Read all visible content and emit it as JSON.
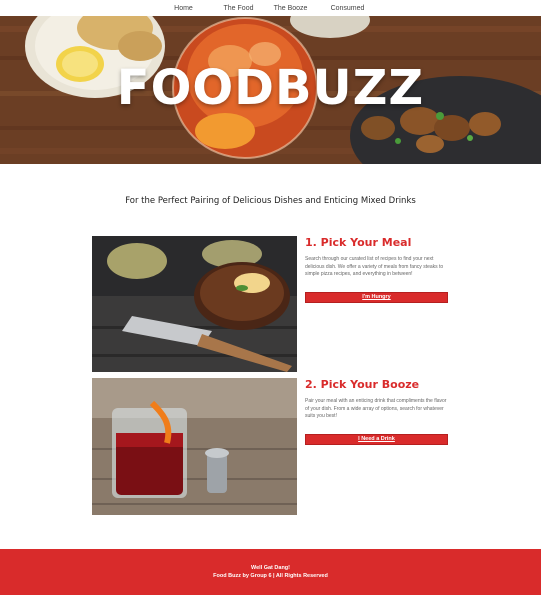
{
  "nav": {
    "items": [
      {
        "label": "Home"
      },
      {
        "label": "The Food"
      },
      {
        "label": "The Booze"
      },
      {
        "label": "Consumed"
      }
    ]
  },
  "hero": {
    "title": "FOODBUZZ"
  },
  "tagline": "For the Perfect Pairing of Delicious Dishes and Enticing Mixed Drinks",
  "cards": [
    {
      "title": "1. Pick Your Meal",
      "description": "Search through our curated list of recipes to find your next delicious dish. We offer a variety of meals from fancy steaks to simple pizza recipes, and everything in between!",
      "button": "I'm Hungry"
    },
    {
      "title": "2. Pick Your Booze",
      "description": "Pair your meal with an enticing drink that compliments the flavor of your dish. From a wide array of options, search for whatever suits you best!",
      "button": "I Need a Drink"
    }
  ],
  "footer": {
    "line1": "Well Gat Dang!",
    "line2": "Food Buzz by Group 6 | All Rights Reserved"
  },
  "colors": {
    "accent": "#d92b2b",
    "footer": "#d92b2b"
  }
}
